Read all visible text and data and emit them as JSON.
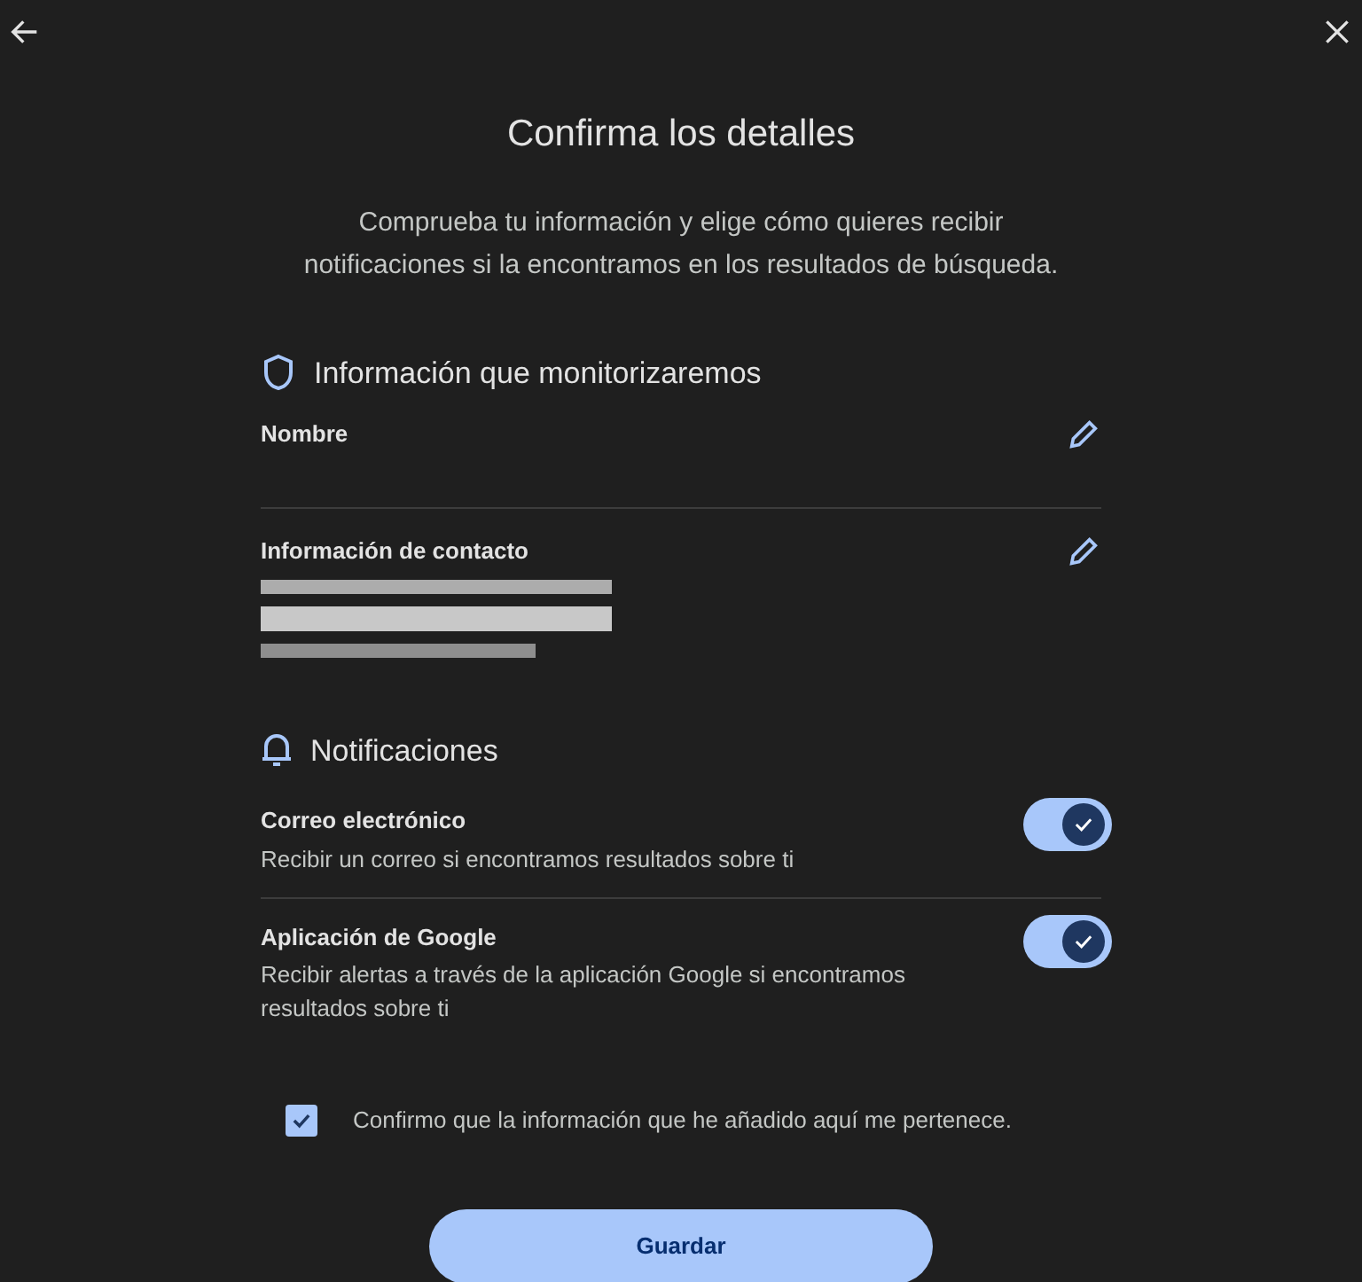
{
  "title": "Confirma los detalles",
  "description": "Comprueba tu información y elige cómo quieres recibir notificaciones si la encontramos en los resultados de búsqueda.",
  "monitored": {
    "heading": "Información que monitorizaremos",
    "fields": [
      {
        "label": "Nombre",
        "obscured": false
      },
      {
        "label": "Información de contacto",
        "obscured": true
      }
    ]
  },
  "notifications": {
    "heading": "Notificaciones",
    "items": [
      {
        "title": "Correo electrónico",
        "description": "Recibir un correo si encontramos resultados sobre ti",
        "on": true
      },
      {
        "title": "Aplicación de Google",
        "description": "Recibir alertas a través de la aplicación Google si encontramos resultados sobre ti",
        "on": true
      }
    ]
  },
  "confirm": {
    "label": "Confirmo que la información que he añadido aquí me pertenece.",
    "checked": true
  },
  "save_button": "Guardar"
}
